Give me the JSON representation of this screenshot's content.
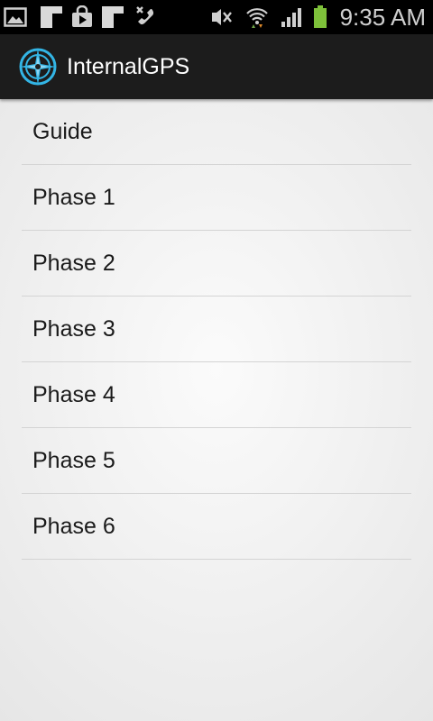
{
  "status_bar": {
    "time": "9:35 AM",
    "left_icons": [
      "gallery-notification-icon",
      "blank-notification-icon",
      "shopping-bag-icon",
      "blank-notification-icon",
      "missed-call-icon"
    ],
    "right_icons": [
      "mute-icon",
      "wifi-icon",
      "signal-icon",
      "battery-icon"
    ]
  },
  "action_bar": {
    "title": "InternalGPS",
    "icon": "compass-icon",
    "accent": "#33b5e5"
  },
  "menu": {
    "items": [
      {
        "label": "Guide"
      },
      {
        "label": "Phase 1"
      },
      {
        "label": "Phase 2"
      },
      {
        "label": "Phase 3"
      },
      {
        "label": "Phase 4"
      },
      {
        "label": "Phase 5"
      },
      {
        "label": "Phase 6"
      }
    ]
  }
}
